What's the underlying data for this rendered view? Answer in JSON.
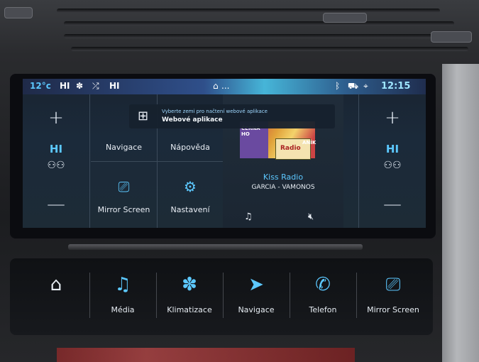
{
  "statusbar": {
    "temp_left": "12°c",
    "fan_left": "HI",
    "fan_right": "HI",
    "time": "12:15",
    "home_dots": "..."
  },
  "left_climate": {
    "plus": "+",
    "level": "HI",
    "minus": "—"
  },
  "right_climate": {
    "plus": "+",
    "level": "HI",
    "minus": "—"
  },
  "notification": {
    "subtitle": "Vyberte zemi pro načtení webové aplikace",
    "title": "Webové aplikace"
  },
  "tiles": {
    "navigace": "Navigace",
    "napoveda": "Nápověda",
    "mirror_screen": "Mirror Screen",
    "nastaveni": "Nastavení"
  },
  "media": {
    "station": "Kiss Radio",
    "track": "GARCIA - VAMONOS",
    "art_text_1": "ČERNÁ HO",
    "art_text_2": "Radio",
    "art_text_3": "ANÍK"
  },
  "touchbar": {
    "items": [
      {
        "label": "",
        "icon": "home-icon"
      },
      {
        "label": "Média",
        "icon": "music-icon"
      },
      {
        "label": "Klimatizace",
        "icon": "fan-icon"
      },
      {
        "label": "Navigace",
        "icon": "navigation-icon"
      },
      {
        "label": "Telefon",
        "icon": "phone-icon"
      },
      {
        "label": "Mirror Screen",
        "icon": "mirror-screen-icon"
      }
    ]
  },
  "colors": {
    "accent": "#5cc8ff",
    "text": "#e9eef5"
  }
}
